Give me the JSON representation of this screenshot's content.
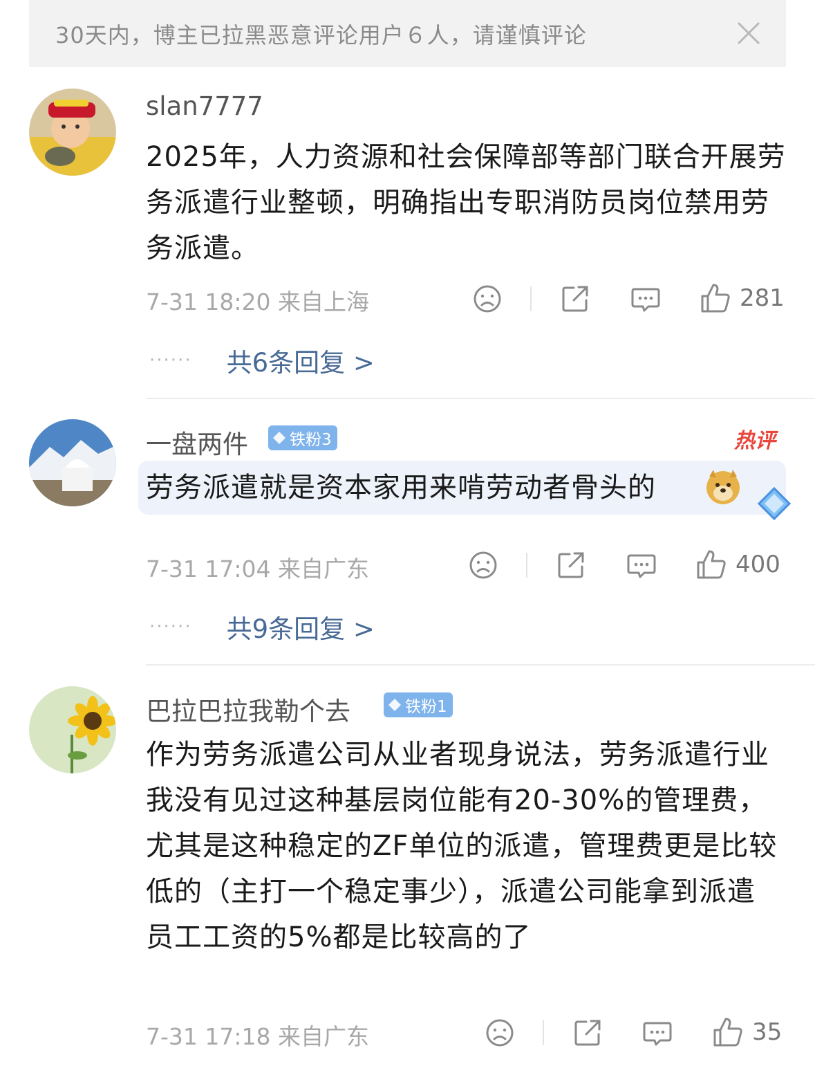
{
  "notice": {
    "text": "30天内，博主已拉黑恶意评论用户６人，请谨慎评论"
  },
  "comments": [
    {
      "username": "slan7777",
      "badge": "",
      "text": "2025年，人力资源和社会保障部等部门联合开展劳务派遣行业整顿，明确指出专职消防员岗位禁用劳务派遣。",
      "meta": "7-31 18:20  来自上海",
      "likes": "281",
      "replies": "共6条回复 >",
      "hot": ""
    },
    {
      "username": "一盘两件",
      "badge": "铁粉3",
      "text": "劳务派遣就是资本家用来啃劳动者骨头的",
      "meta": "7-31 17:04  来自广东",
      "likes": "400",
      "replies": "共9条回复 >",
      "hot": "热评"
    },
    {
      "username": "巴拉巴拉我勒个去",
      "badge": "铁粉1",
      "text": "作为劳务派遣公司从业者现身说法，劳务派遣行业我没有见过这种基层岗位能有20-30%的管理费，尤其是这种稳定的ZF单位的派遣，管理费更是比较低的（主打一个稳定事少），派遣公司能拿到派遣员工工资的5%都是比较高的了",
      "meta": "7-31 17:18  来自广东",
      "likes": "35",
      "replies": "",
      "hot": ""
    }
  ],
  "reply_dots": "······",
  "icons": {
    "close": "close-icon",
    "dislike": "sad-face-icon",
    "share": "share-icon",
    "comment": "comment-icon",
    "like": "thumbs-up-icon",
    "gem": "diamond-icon",
    "emoji": "doge-emoji-icon"
  },
  "colors": {
    "link": "#486a96",
    "badge": "#7fb3ec",
    "hot": "#e9463c",
    "notice_bg": "#f2f2f2"
  }
}
